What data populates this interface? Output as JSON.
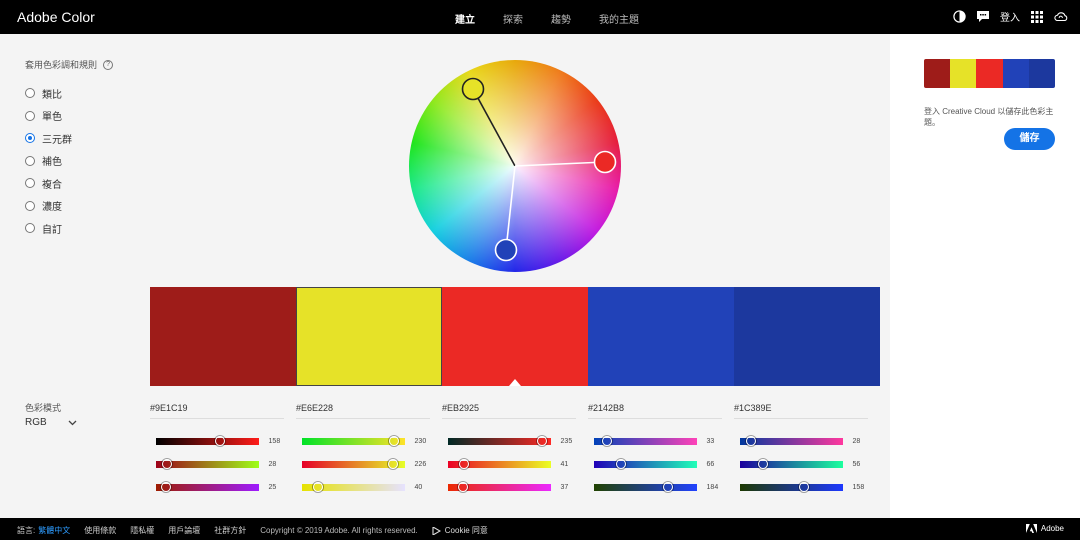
{
  "app": {
    "title": "Adobe Color"
  },
  "nav": {
    "items": [
      {
        "label": "建立",
        "active": true
      },
      {
        "label": "探索",
        "active": false
      },
      {
        "label": "趨勢",
        "active": false
      },
      {
        "label": "我的主題",
        "active": false
      }
    ]
  },
  "topbar": {
    "signin": "登入",
    "icons": [
      "color-blind-icon",
      "chat-icon",
      "apps-grid-icon",
      "creative-cloud-icon"
    ]
  },
  "rules": {
    "title": "套用色彩調和規則",
    "help": "?",
    "selected_index": 2,
    "items": [
      "類比",
      "單色",
      "三元群",
      "補色",
      "複合",
      "濃度",
      "自訂"
    ]
  },
  "color_mode": {
    "label": "色彩模式",
    "value": "RGB"
  },
  "wheel": {
    "handles": [
      {
        "color": "#E6E228"
      },
      {
        "color": "#EB2925"
      },
      {
        "color": "#2142B8"
      }
    ]
  },
  "swatches": [
    {
      "hex": "#9E1C19",
      "color": "#9E1C19",
      "sliders": [
        {
          "value": 158,
          "gradient": [
            "#000000",
            "#ff1c19"
          ]
        },
        {
          "value": 28,
          "gradient": [
            "#9e0019",
            "#9eff19"
          ]
        },
        {
          "value": 25,
          "gradient": [
            "#9e1c00",
            "#9e1cff"
          ]
        }
      ]
    },
    {
      "hex": "#E6E228",
      "color": "#E6E228",
      "sliders": [
        {
          "value": 230,
          "gradient": [
            "#00e228",
            "#ffe228"
          ]
        },
        {
          "value": 226,
          "gradient": [
            "#e60028",
            "#e6ff28"
          ]
        },
        {
          "value": 40,
          "gradient": [
            "#e6e200",
            "#e6e2ff"
          ]
        }
      ]
    },
    {
      "hex": "#EB2925",
      "color": "#EB2925",
      "sliders": [
        {
          "value": 235,
          "gradient": [
            "#002925",
            "#ff2925"
          ]
        },
        {
          "value": 41,
          "gradient": [
            "#eb0025",
            "#ebff25"
          ]
        },
        {
          "value": 37,
          "gradient": [
            "#eb2900",
            "#eb29ff"
          ]
        }
      ]
    },
    {
      "hex": "#2142B8",
      "color": "#2142B8",
      "sliders": [
        {
          "value": 33,
          "gradient": [
            "#0042b8",
            "#ff42b8"
          ]
        },
        {
          "value": 66,
          "gradient": [
            "#2100b8",
            "#21ffb8"
          ]
        },
        {
          "value": 184,
          "gradient": [
            "#214200",
            "#2142ff"
          ]
        }
      ]
    },
    {
      "hex": "#1C389E",
      "color": "#1C389E",
      "sliders": [
        {
          "value": 28,
          "gradient": [
            "#00389e",
            "#ff389e"
          ]
        },
        {
          "value": 56,
          "gradient": [
            "#1c009e",
            "#1cff9e"
          ]
        },
        {
          "value": 158,
          "gradient": [
            "#1c3800",
            "#1c38ff"
          ]
        }
      ]
    }
  ],
  "selected_swatch": 2,
  "right_panel": {
    "cc_text": "登入 Creative Cloud 以儲存此色彩主題。",
    "save_label": "儲存"
  },
  "footer": {
    "lang_label": "語言:",
    "lang_value": "繁體中文",
    "links": [
      "使用條款",
      "隱私權",
      "用戶論壇",
      "社群方針"
    ],
    "copyright": "Copyright © 2019 Adobe. All rights reserved.",
    "cookie": "Cookie 同意",
    "brand": "Adobe"
  }
}
